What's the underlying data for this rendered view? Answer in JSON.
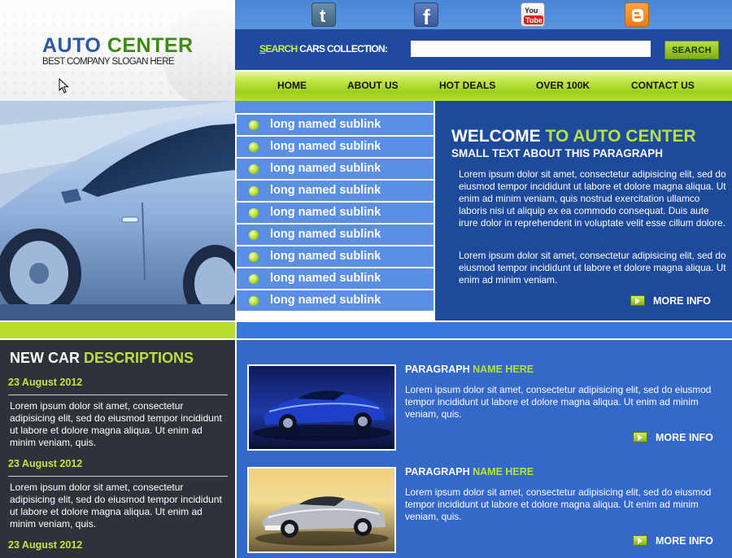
{
  "header": {
    "logo_word1": "AUTO",
    "logo_word2": "CENTER",
    "slogan": "BEST COMPANY SLOGAN HERE"
  },
  "social": [
    {
      "name": "twitter",
      "glyph": "t"
    },
    {
      "name": "facebook",
      "glyph": "f"
    },
    {
      "name": "youtube",
      "glyph1": "You",
      "glyph2": "Tube"
    },
    {
      "name": "blogger",
      "glyph": "B"
    }
  ],
  "search": {
    "label_first_letter": "S",
    "label_rest_accent": "EARCH",
    "label_tail": " CARS COLLECTION:",
    "input_value": "",
    "button_label": "SEARCH"
  },
  "nav": {
    "items": [
      "HOME",
      "ABOUT US",
      "HOT DEALS",
      "OVER 100K",
      "CONTACT US"
    ]
  },
  "sidebar": {
    "sublinks": [
      "long named sublink",
      "long named sublink",
      "long named sublink",
      "long named sublink",
      "long named sublink",
      "long named sublink",
      "long named sublink",
      "long named sublink",
      "long named sublink"
    ]
  },
  "welcome": {
    "title_white": "WELCOME ",
    "title_accent": "TO AUTO CENTER",
    "subtitle": "SMALL TEXT ABOUT THIS PARAGRAPH",
    "paragraphs": [
      "Lorem ipsum dolor sit amet, consectetur adipisicing elit, sed do eiusmod tempor incididunt ut labore et dolore magna aliqua. Ut enim ad minim veniam, quis nostrud exercitation ullamco laboris nisi ut aliquip ex ea commodo consequat. Duis aute irure dolor in reprehenderit in voluptate velit esse cillum dolore.",
      "Lorem ipsum dolor sit amet, consectetur adipisicing elit, sed do eiusmod tempor incididunt ut labore et dolore magna aliqua. Ut enim ad minim veniam."
    ],
    "more_label": "MORE INFO"
  },
  "news": {
    "title_white": "NEW CAR ",
    "title_accent": "DESCRIPTIONS",
    "items": [
      {
        "date": "23 August 2012",
        "text": "Lorem ipsum dolor sit amet, consectetur adipisicing elit, sed do eiusmod tempor incididunt ut labore et dolore magna aliqua. Ut enim ad minim veniam, quis."
      },
      {
        "date": "23 August 2012",
        "text": "Lorem ipsum dolor sit amet, consectetur adipisicing elit, sed do eiusmod tempor incididunt ut labore et dolore magna aliqua. Ut enim ad minim veniam, quis."
      },
      {
        "date": "23 August 2012",
        "text": ""
      }
    ]
  },
  "content": {
    "items": [
      {
        "title_white": "PARAGRAPH ",
        "title_accent": "NAME HERE",
        "text": "Lorem ipsum dolor sit amet, consectetur adipisicing elit, sed do eiusmod tempor incididunt ut labore et dolore magna aliqua. Ut enim ad minim veniam, quis.",
        "more_label": "MORE INFO"
      },
      {
        "title_white": "PARAGRAPH ",
        "title_accent": "NAME HERE",
        "text": "Lorem ipsum dolor sit amet, consectetur adipisicing elit, sed do eiusmod tempor incididunt ut labore et dolore magna aliqua. Ut enim ad minim veniam, quis.",
        "more_label": "MORE INFO"
      }
    ]
  },
  "colors": {
    "accent_green": "#b6e041",
    "dark_blue": "#1e4a9c",
    "mid_blue": "#3468c9",
    "light_blue": "#5b8fe3",
    "dark_panel": "#2f3339"
  }
}
